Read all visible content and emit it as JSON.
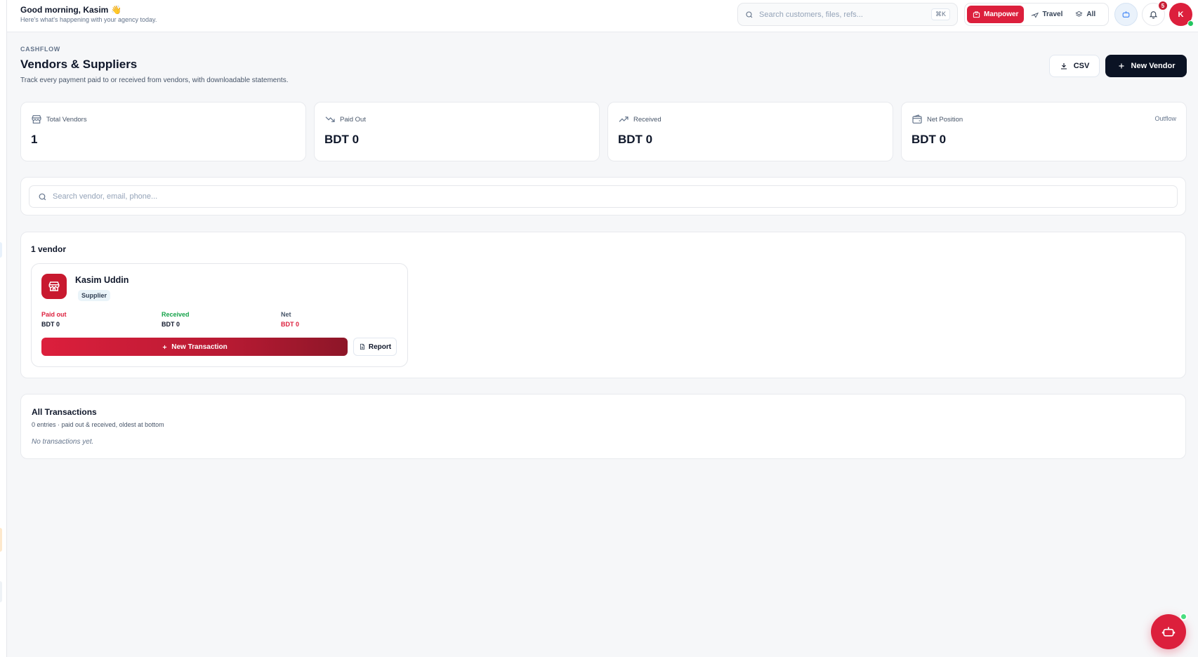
{
  "colors": {
    "brand": "#dc1f3c",
    "dark": "#0b1324",
    "paid_out": "#dc1f3c",
    "received": "#16a34a",
    "net": "#dc1f3c"
  },
  "header": {
    "greeting": "Good morning, Kasim",
    "greeting_emoji": "👋",
    "greeting_sub": "Here's what's happening with your agency today.",
    "search_placeholder": "Search customers, files, refs...",
    "search_shortcut": "⌘K",
    "segments": [
      {
        "label": "Manpower",
        "icon": "building-icon",
        "active": true
      },
      {
        "label": "Travel",
        "icon": "plane-icon",
        "active": false
      },
      {
        "label": "All",
        "icon": "layers-icon",
        "active": false
      }
    ],
    "notifications_count": "5",
    "avatar_initial": "K"
  },
  "page": {
    "eyebrow": "CASHFLOW",
    "title": "Vendors & Suppliers",
    "subtitle": "Track every payment paid to or received from vendors, with downloadable statements.",
    "csv_label": "CSV",
    "new_vendor_label": "New Vendor"
  },
  "stats": [
    {
      "label": "Total Vendors",
      "value": "1",
      "icon": "store-icon",
      "tag": ""
    },
    {
      "label": "Paid Out",
      "value": "BDT 0",
      "icon": "trending-down-icon",
      "tag": ""
    },
    {
      "label": "Received",
      "value": "BDT 0",
      "icon": "trending-up-icon",
      "tag": ""
    },
    {
      "label": "Net Position",
      "value": "BDT 0",
      "icon": "wallet-icon",
      "tag": "Outflow"
    }
  ],
  "filter": {
    "search_placeholder": "Search vendor, email, phone..."
  },
  "vendors": {
    "count_label": "1 vendor",
    "items": [
      {
        "name": "Kasim Uddin",
        "type": "Supplier",
        "paid_out_label": "Paid out",
        "paid_out": "BDT 0",
        "received_label": "Received",
        "received": "BDT 0",
        "net_label": "Net",
        "net": "BDT 0",
        "new_txn_label": "New Transaction",
        "report_label": "Report"
      }
    ]
  },
  "transactions": {
    "title": "All Transactions",
    "subtitle": "0 entries · paid out & received, oldest at bottom",
    "empty": "No transactions yet."
  }
}
